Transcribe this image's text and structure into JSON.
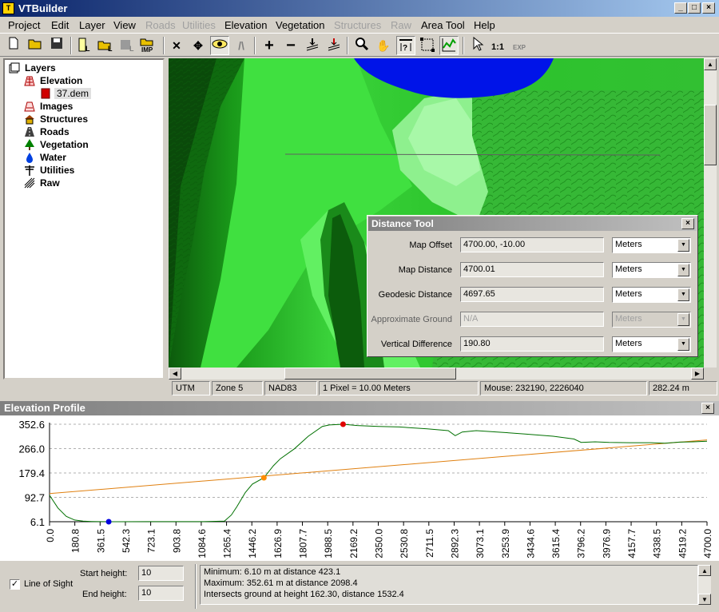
{
  "app": {
    "title": "VTBuilder",
    "icon": "vtbuilder-app-icon"
  },
  "menu": [
    {
      "label": "Project",
      "enabled": true
    },
    {
      "label": "Edit",
      "enabled": true
    },
    {
      "label": "Layer",
      "enabled": true
    },
    {
      "label": "View",
      "enabled": true
    },
    {
      "label": "Roads",
      "enabled": false
    },
    {
      "label": "Utilities",
      "enabled": false
    },
    {
      "label": "Elevation",
      "enabled": true
    },
    {
      "label": "Vegetation",
      "enabled": true
    },
    {
      "label": "Structures",
      "enabled": false
    },
    {
      "label": "Raw",
      "enabled": false
    },
    {
      "label": "Area Tool",
      "enabled": true
    },
    {
      "label": "Help",
      "enabled": true
    }
  ],
  "toolbar": {
    "one_to_one_label": "1:1",
    "exp_label": "EXP"
  },
  "layers": {
    "root_label": "Layers",
    "items": [
      {
        "label": "Elevation",
        "icon": "elevation-grid-icon"
      },
      {
        "label": "37.dem",
        "icon": "dem-file-icon",
        "child": true
      },
      {
        "label": "Images",
        "icon": "images-icon"
      },
      {
        "label": "Structures",
        "icon": "house-icon"
      },
      {
        "label": "Roads",
        "icon": "road-icon"
      },
      {
        "label": "Vegetation",
        "icon": "tree-icon"
      },
      {
        "label": "Water",
        "icon": "water-drop-icon"
      },
      {
        "label": "Utilities",
        "icon": "utility-pole-icon"
      },
      {
        "label": "Raw",
        "icon": "raw-data-icon"
      }
    ]
  },
  "status": {
    "projection": "UTM",
    "zone": "Zone 5",
    "datum": "NAD83",
    "pixel_size": "1 Pixel = 10.00 Meters",
    "mouse": "Mouse: 232190, 2226040",
    "elevation": "282.24 m"
  },
  "distance_tool": {
    "title": "Distance Tool",
    "rows": [
      {
        "label": "Map Offset",
        "value": "4700.00, -10.00",
        "unit": "Meters",
        "enabled": true
      },
      {
        "label": "Map Distance",
        "value": "4700.01",
        "unit": "Meters",
        "enabled": true
      },
      {
        "label": "Geodesic Distance",
        "value": "4697.65",
        "unit": "Meters",
        "enabled": true
      },
      {
        "label": "Approximate Ground",
        "value": "N/A",
        "unit": "Meters",
        "enabled": false
      },
      {
        "label": "Vertical Difference",
        "value": "190.80",
        "unit": "Meters",
        "enabled": true
      }
    ]
  },
  "elevation_profile": {
    "title": "Elevation Profile",
    "line_of_sight_label": "Line of Sight",
    "line_of_sight_checked": true,
    "start_height_label": "Start height:",
    "start_height": "10",
    "end_height_label": "End height:",
    "end_height": "10",
    "info": [
      "Minimum: 6.10 m at distance 423.1",
      "Maximum: 352.61 m at distance 2098.4",
      "Intersects ground at height 162.30, distance 1532.4"
    ]
  },
  "chart_data": {
    "type": "line",
    "title": "",
    "xlabel": "",
    "ylabel": "",
    "xlim": [
      0,
      4700
    ],
    "ylim": [
      6.1,
      352.6
    ],
    "y_ticks": [
      "352.6",
      "266.0",
      "179.4",
      "92.7",
      "6.1"
    ],
    "x_ticks": [
      "0.0",
      "180.8",
      "361.5",
      "542.3",
      "723.1",
      "903.8",
      "1084.6",
      "1265.4",
      "1446.2",
      "1626.9",
      "1807.7",
      "1988.5",
      "2169.2",
      "2350.0",
      "2530.8",
      "2711.5",
      "2892.3",
      "3073.1",
      "3253.9",
      "3434.6",
      "3615.4",
      "3796.2",
      "3976.9",
      "4157.7",
      "4338.5",
      "4519.2",
      "4700.0"
    ],
    "grid": true,
    "series": [
      {
        "color": "#007000",
        "x": [
          0,
          60,
          120,
          180,
          240,
          300,
          350,
          423.1,
          500,
          700,
          900,
          1100,
          1250,
          1300,
          1340,
          1400,
          1450,
          1532.4,
          1600,
          1650,
          1750,
          1850,
          1950,
          2000,
          2098.4,
          2200,
          2350,
          2500,
          2700,
          2850,
          2900,
          2950,
          3050,
          3200,
          3400,
          3600,
          3750,
          3800,
          3900,
          4000,
          4150,
          4300,
          4400,
          4500,
          4600,
          4700
        ],
        "y": [
          100,
          55,
          25,
          12,
          8,
          7,
          6.5,
          6.1,
          6.2,
          6.5,
          6.3,
          6.5,
          8,
          30,
          60,
          110,
          140,
          162.3,
          205,
          230,
          265,
          310,
          345,
          350,
          352.61,
          348,
          345,
          343,
          336,
          330,
          312,
          325,
          330,
          325,
          318,
          310,
          300,
          288,
          290,
          288,
          287,
          287,
          285,
          289,
          290,
          292
        ]
      },
      {
        "color": "#e08010",
        "x": [
          0,
          4700
        ],
        "y": [
          106.1,
          296.9
        ]
      }
    ],
    "markers": [
      {
        "x": 423.1,
        "y": 6.1,
        "color": "#0000e0"
      },
      {
        "x": 2098.4,
        "y": 352.61,
        "color": "#e00000"
      },
      {
        "x": 1532.4,
        "y": 162.3,
        "color": "#ff8c00"
      }
    ]
  }
}
